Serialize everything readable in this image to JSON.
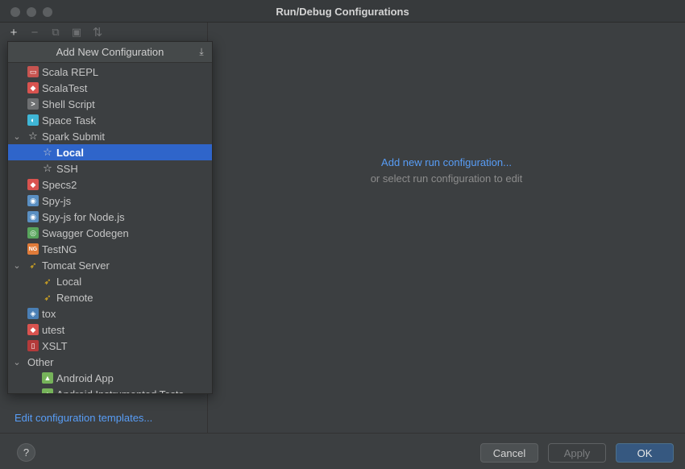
{
  "window": {
    "title": "Run/Debug Configurations"
  },
  "toolbar": {
    "icons": [
      "add-icon",
      "remove-icon",
      "copy-icon",
      "folder-icon",
      "sort-icon"
    ],
    "add_glyph": "+",
    "remove_glyph": "−",
    "copy_glyph": "⧉",
    "folder_glyph": "▣",
    "sort_glyph": "⇅"
  },
  "popup": {
    "title": "Add New Configuration",
    "pin_glyph": "⤓",
    "items": [
      {
        "label": "Scala REPL",
        "icon": "scala-repl-icon",
        "color": "#c75450",
        "glyph": "▭"
      },
      {
        "label": "ScalaTest",
        "icon": "scalatest-icon",
        "color": "#d9534f",
        "glyph": "◆"
      },
      {
        "label": "Shell Script",
        "icon": "shell-script-icon",
        "color": "#6e7072",
        "glyph": ">"
      },
      {
        "label": "Space Task",
        "icon": "space-task-icon",
        "color": "#3fb6d6",
        "glyph": "◐"
      },
      {
        "label": "Spark Submit",
        "icon": "spark-icon",
        "chevron": "⌄",
        "glyph": "☆"
      },
      {
        "label": "Local",
        "icon": "spark-local-icon",
        "glyph": "☆",
        "selected": true
      },
      {
        "label": "SSH",
        "icon": "spark-ssh-icon",
        "glyph": "☆"
      },
      {
        "label": "Specs2",
        "icon": "specs2-icon",
        "color": "#d9534f",
        "glyph": "◆"
      },
      {
        "label": "Spy-js",
        "icon": "spy-js-icon",
        "color": "#5a8fc2",
        "glyph": "◉"
      },
      {
        "label": "Spy-js for Node.js",
        "icon": "spy-js-node-icon",
        "color": "#5a8fc2",
        "glyph": "◉"
      },
      {
        "label": "Swagger Codegen",
        "icon": "swagger-icon",
        "color": "#58a55c",
        "glyph": "◎"
      },
      {
        "label": "TestNG",
        "icon": "testng-icon",
        "color": "#e07b39",
        "glyph": "NG"
      },
      {
        "label": "Tomcat Server",
        "icon": "tomcat-icon",
        "chevron": "⌄",
        "glyph": "➶"
      },
      {
        "label": "Local",
        "icon": "tomcat-local-icon",
        "glyph": "➶"
      },
      {
        "label": "Remote",
        "icon": "tomcat-remote-icon",
        "glyph": "➶"
      },
      {
        "label": "tox",
        "icon": "python-icon",
        "color": "#4a7fb5",
        "glyph": "◈"
      },
      {
        "label": "utest",
        "icon": "utest-icon",
        "color": "#d9534f",
        "glyph": "◆"
      },
      {
        "label": "XSLT",
        "icon": "xslt-icon",
        "color": "#b33a3a",
        "glyph": "▯"
      },
      {
        "label": "Other",
        "icon": "",
        "chevron": "⌄",
        "glyph": ""
      },
      {
        "label": "Android App",
        "icon": "android-icon",
        "color": "#76b35a",
        "glyph": "▲"
      },
      {
        "label": "Android Instrumented Tests",
        "icon": "android-test-icon",
        "color": "#76b35a",
        "glyph": "▲"
      }
    ]
  },
  "left": {
    "edit_templates_link": "Edit configuration templates..."
  },
  "main": {
    "add_link": "Add new run configuration...",
    "hint": "or select run configuration to edit"
  },
  "footer": {
    "help_glyph": "?",
    "cancel": "Cancel",
    "apply": "Apply",
    "ok": "OK"
  }
}
